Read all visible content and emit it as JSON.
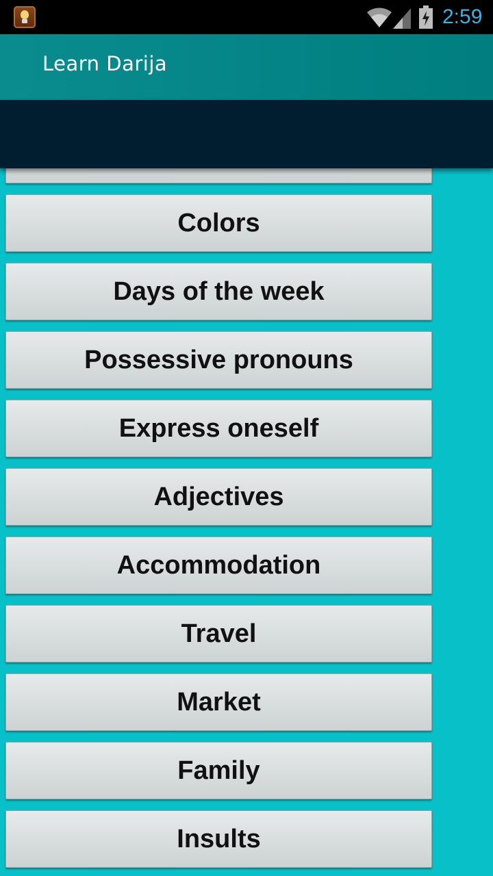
{
  "status_bar": {
    "time": "2:59",
    "icons": [
      "lightbulb-app-icon",
      "wifi-icon",
      "signal-icon",
      "battery-charging-icon"
    ],
    "clock_color": "#33b5e5"
  },
  "action_bar": {
    "title": "Learn Darija",
    "color": "#00807f"
  },
  "banner": {
    "color": "#011e30"
  },
  "topics": [
    {
      "label": ""
    },
    {
      "label": "Colors"
    },
    {
      "label": "Days of the week"
    },
    {
      "label": "Possessive pronouns"
    },
    {
      "label": "Express oneself"
    },
    {
      "label": "Adjectives"
    },
    {
      "label": "Accommodation"
    },
    {
      "label": "Travel"
    },
    {
      "label": "Market"
    },
    {
      "label": "Family"
    },
    {
      "label": "Insults"
    }
  ],
  "background_color": "#08c0c8"
}
